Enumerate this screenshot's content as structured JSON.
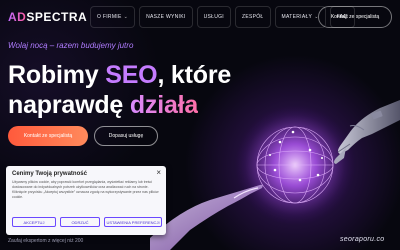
{
  "brand": {
    "logo_mark": "AD",
    "logo_text": "SPECTRA"
  },
  "nav": {
    "items": [
      {
        "label": "O FIRMIE",
        "has_dropdown": true
      },
      {
        "label": "NASZE WYNIKI",
        "has_dropdown": false
      },
      {
        "label": "USŁUGI",
        "has_dropdown": false
      },
      {
        "label": "ZESPÓŁ",
        "has_dropdown": false
      },
      {
        "label": "MATERIAŁY",
        "has_dropdown": true
      },
      {
        "label": "FAQ",
        "has_dropdown": false
      }
    ],
    "cta_label": "Kontakt ze specjalistą"
  },
  "hero": {
    "tagline": "Wolaj nocą – razem budujemy jutro",
    "headline_part1": "Robimy ",
    "headline_accent": "SEO",
    "headline_part2": ", które",
    "headline_line2": "naprawdę ",
    "headline_accent2": "działa",
    "primary_button": "Kontakt ze specjalistą",
    "secondary_button": "Dopasuj usługę"
  },
  "cookie": {
    "title": "Cenimy Twoją prywatność",
    "close_icon": "close-icon",
    "text": "Używamy plików cookie, aby poprawić komfort przeglądania, wyświetlać reklamy lub treści dostosowane do indywidualnych potrzeb użytkowników oraz analizować ruch na stronie. Kliknięcie przycisku „Akceptuj wszystkie” oznacza zgodę na wykorzystywanie przez nas plików cookie.",
    "accept_label": "AKCEPTUJ",
    "reject_label": "ODRZUĆ",
    "settings_label": "USTAWIENIA PREFERENCJI"
  },
  "below_cookie_text": "Zaufaj ekspertom z więcej niż 200",
  "watermark": "seoraporu.co",
  "colors": {
    "accent_purple": "#c57cff",
    "accent_orange": "#ff5a3c",
    "background": "#07070f"
  }
}
